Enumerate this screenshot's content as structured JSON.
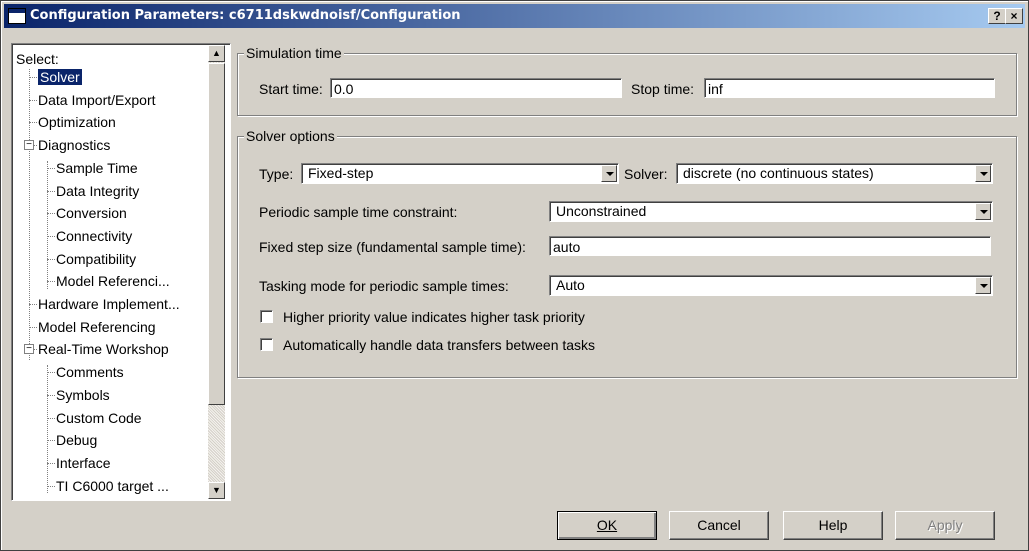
{
  "window": {
    "title": "Configuration Parameters: c6711dskwdnoisf/Configuration",
    "help_btn": "?",
    "close_btn": "×"
  },
  "tree": {
    "header": "Select:",
    "items": [
      {
        "label": "Solver",
        "level": 0,
        "selected": true
      },
      {
        "label": "Data Import/Export",
        "level": 0
      },
      {
        "label": "Optimization",
        "level": 0
      },
      {
        "label": "Diagnostics",
        "level": 0,
        "expandable": true
      },
      {
        "label": "Sample Time",
        "level": 1
      },
      {
        "label": "Data Integrity",
        "level": 1
      },
      {
        "label": "Conversion",
        "level": 1
      },
      {
        "label": "Connectivity",
        "level": 1
      },
      {
        "label": "Compatibility",
        "level": 1
      },
      {
        "label": "Model Referenci...",
        "level": 1
      },
      {
        "label": "Hardware Implement...",
        "level": 0
      },
      {
        "label": "Model Referencing",
        "level": 0
      },
      {
        "label": "Real-Time Workshop",
        "level": 0,
        "expandable": true
      },
      {
        "label": "Comments",
        "level": 1
      },
      {
        "label": "Symbols",
        "level": 1
      },
      {
        "label": "Custom Code",
        "level": 1
      },
      {
        "label": "Debug",
        "level": 1
      },
      {
        "label": "Interface",
        "level": 1
      },
      {
        "label": "TI C6000 target ...",
        "level": 1
      }
    ]
  },
  "simulation_time": {
    "group_label": "Simulation time",
    "start_label": "Start time:",
    "start_value": "0.0",
    "stop_label": "Stop time:",
    "stop_value": "inf"
  },
  "solver_options": {
    "group_label": "Solver options",
    "type_label": "Type:",
    "type_value": "Fixed-step",
    "solver_label": "Solver:",
    "solver_value": "discrete (no continuous states)",
    "periodic_label": "Periodic sample time constraint:",
    "periodic_value": "Unconstrained",
    "fixed_step_label": "Fixed step size (fundamental sample time):",
    "fixed_step_value": "auto",
    "tasking_label": "Tasking mode for periodic sample times:",
    "tasking_value": "Auto",
    "higher_priority_label": "Higher priority value indicates higher task priority",
    "higher_priority_checked": false,
    "auto_handle_label": "Automatically handle data transfers between tasks",
    "auto_handle_checked": false
  },
  "buttons": {
    "ok": "OK",
    "cancel": "Cancel",
    "help": "Help",
    "apply": "Apply"
  }
}
